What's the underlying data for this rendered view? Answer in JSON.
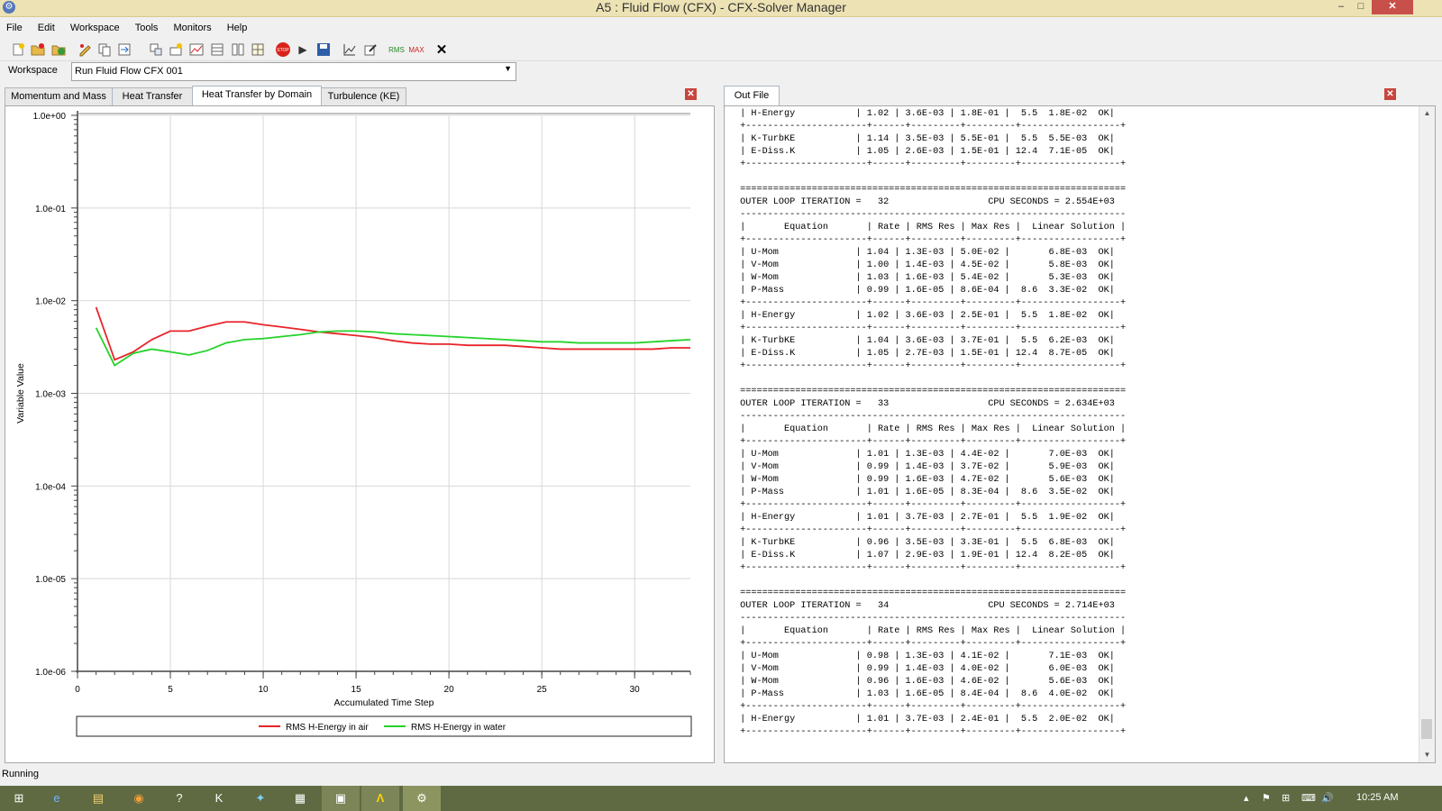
{
  "window": {
    "title": "A5 : Fluid Flow (CFX) - CFX-Solver Manager",
    "minimize": "–",
    "maximize": "□",
    "close": "✕"
  },
  "menu": [
    "File",
    "Edit",
    "Workspace",
    "Tools",
    "Monitors",
    "Help"
  ],
  "toolbar_icons": [
    "new-run-icon",
    "open-icon",
    "restart-icon",
    "edit-icon",
    "copy-icon",
    "sync-icon",
    "arrange-icon",
    "layout-icon",
    "monitor-icon",
    "grid-icon",
    "table-icon",
    "layout2-icon",
    "stop-icon",
    "play-icon",
    "save-icon",
    "chart-edit-icon",
    "pencil-icon",
    "rms-icon",
    "max-icon",
    "close-icon"
  ],
  "toolbar_glyphs": {
    "stop": "STOP",
    "play": "▶",
    "rms": "RMS",
    "max": "MAX",
    "close": "✕"
  },
  "workspace": {
    "label": "Workspace",
    "value": "Run Fluid Flow CFX 001"
  },
  "tabs": [
    "Momentum and Mass",
    "Heat Transfer",
    "Heat Transfer by Domain",
    "Turbulence (KE)"
  ],
  "active_tab": 2,
  "out_tab": "Out File",
  "chart_data": {
    "type": "line",
    "xlabel": "Accumulated Time Step",
    "ylabel": "Variable Value",
    "yscale": "log",
    "xlim": [
      0,
      33
    ],
    "ylim": [
      1e-06,
      1.0
    ],
    "x_ticks": [
      0,
      5,
      10,
      15,
      20,
      25,
      30
    ],
    "y_ticks": [
      1.0,
      0.1,
      0.01,
      0.001,
      0.0001,
      1e-05,
      1e-06
    ],
    "y_tick_labels": [
      "1.0e+00",
      "1.0e-01",
      "1.0e-02",
      "1.0e-03",
      "1.0e-04",
      "1.0e-05",
      "1.0e-06"
    ],
    "grid": true,
    "legend_position": "bottom",
    "series": [
      {
        "name": "RMS H-Energy in air",
        "color": "#e8242a",
        "x": [
          1,
          2,
          3,
          4,
          5,
          6,
          7,
          8,
          9,
          10,
          11,
          12,
          13,
          14,
          15,
          16,
          17,
          18,
          19,
          20,
          21,
          22,
          23,
          24,
          25,
          26,
          27,
          28,
          29,
          30,
          31,
          32,
          33
        ],
        "y": [
          0.0085,
          0.0023,
          0.0028,
          0.0038,
          0.0047,
          0.0047,
          0.0053,
          0.0059,
          0.0059,
          0.0055,
          0.0052,
          0.0049,
          0.0046,
          0.0044,
          0.0042,
          0.004,
          0.0037,
          0.0035,
          0.0034,
          0.0034,
          0.0033,
          0.0033,
          0.0033,
          0.0032,
          0.0031,
          0.003,
          0.003,
          0.003,
          0.003,
          0.003,
          0.003,
          0.0031,
          0.0031
        ]
      },
      {
        "name": "RMS H-Energy in water",
        "color": "#25d22a",
        "x": [
          1,
          2,
          3,
          4,
          5,
          6,
          7,
          8,
          9,
          10,
          11,
          12,
          13,
          14,
          15,
          16,
          17,
          18,
          19,
          20,
          21,
          22,
          23,
          24,
          25,
          26,
          27,
          28,
          29,
          30,
          31,
          32,
          33
        ],
        "y": [
          0.0051,
          0.002,
          0.0027,
          0.003,
          0.0028,
          0.0026,
          0.0029,
          0.0035,
          0.0038,
          0.0039,
          0.0041,
          0.0043,
          0.0046,
          0.0047,
          0.0047,
          0.0046,
          0.0044,
          0.0043,
          0.0042,
          0.0041,
          0.004,
          0.0039,
          0.0038,
          0.0037,
          0.0036,
          0.0036,
          0.0035,
          0.0035,
          0.0035,
          0.0035,
          0.0036,
          0.0037,
          0.0038
        ]
      }
    ]
  },
  "out_file_text": " | H-Energy           | 1.02 | 3.6E-03 | 1.8E-01 |  5.5  1.8E-02  OK|\n +----------------------+------+---------+---------+------------------+\n | K-TurbKE           | 1.14 | 3.5E-03 | 5.5E-01 |  5.5  5.5E-03  OK|\n | E-Diss.K           | 1.05 | 2.6E-03 | 1.5E-01 | 12.4  7.1E-05  OK|\n +----------------------+------+---------+---------+------------------+\n\n ======================================================================\n OUTER LOOP ITERATION =   32                  CPU SECONDS = 2.554E+03\n ----------------------------------------------------------------------\n |       Equation       | Rate | RMS Res | Max Res |  Linear Solution |\n +----------------------+------+---------+---------+------------------+\n | U-Mom              | 1.04 | 1.3E-03 | 5.0E-02 |       6.8E-03  OK|\n | V-Mom              | 1.00 | 1.4E-03 | 4.5E-02 |       5.8E-03  OK|\n | W-Mom              | 1.03 | 1.6E-03 | 5.4E-02 |       5.3E-03  OK|\n | P-Mass             | 0.99 | 1.6E-05 | 8.6E-04 |  8.6  3.3E-02  OK|\n +----------------------+------+---------+---------+------------------+\n | H-Energy           | 1.02 | 3.6E-03 | 2.5E-01 |  5.5  1.8E-02  OK|\n +----------------------+------+---------+---------+------------------+\n | K-TurbKE           | 1.04 | 3.6E-03 | 3.7E-01 |  5.5  6.2E-03  OK|\n | E-Diss.K           | 1.05 | 2.7E-03 | 1.5E-01 | 12.4  8.7E-05  OK|\n +----------------------+------+---------+---------+------------------+\n\n ======================================================================\n OUTER LOOP ITERATION =   33                  CPU SECONDS = 2.634E+03\n ----------------------------------------------------------------------\n |       Equation       | Rate | RMS Res | Max Res |  Linear Solution |\n +----------------------+------+---------+---------+------------------+\n | U-Mom              | 1.01 | 1.3E-03 | 4.4E-02 |       7.0E-03  OK|\n | V-Mom              | 0.99 | 1.4E-03 | 3.7E-02 |       5.9E-03  OK|\n | W-Mom              | 0.99 | 1.6E-03 | 4.7E-02 |       5.6E-03  OK|\n | P-Mass             | 1.01 | 1.6E-05 | 8.3E-04 |  8.6  3.5E-02  OK|\n +----------------------+------+---------+---------+------------------+\n | H-Energy           | 1.01 | 3.7E-03 | 2.7E-01 |  5.5  1.9E-02  OK|\n +----------------------+------+---------+---------+------------------+\n | K-TurbKE           | 0.96 | 3.5E-03 | 3.3E-01 |  5.5  6.8E-03  OK|\n | E-Diss.K           | 1.07 | 2.9E-03 | 1.9E-01 | 12.4  8.2E-05  OK|\n +----------------------+------+---------+---------+------------------+\n\n ======================================================================\n OUTER LOOP ITERATION =   34                  CPU SECONDS = 2.714E+03\n ----------------------------------------------------------------------\n |       Equation       | Rate | RMS Res | Max Res |  Linear Solution |\n +----------------------+------+---------+---------+------------------+\n | U-Mom              | 0.98 | 1.3E-03 | 4.1E-02 |       7.1E-03  OK|\n | V-Mom              | 0.99 | 1.4E-03 | 4.0E-02 |       6.0E-03  OK|\n | W-Mom              | 0.96 | 1.6E-03 | 4.6E-02 |       5.6E-03  OK|\n | P-Mass             | 1.03 | 1.6E-05 | 8.4E-04 |  8.6  4.0E-02  OK|\n +----------------------+------+---------+---------+------------------+\n | H-Energy           | 1.01 | 3.7E-03 | 2.4E-01 |  5.5  2.0E-02  OK|\n +----------------------+------+---------+---------+------------------+",
  "status": "Running",
  "taskbar": {
    "items": [
      "windows-start-icon",
      "ie-icon",
      "file-explorer-icon",
      "chrome-icon",
      "help-icon",
      "k-icon",
      "butterfly-icon",
      "app-icon",
      "folder-icon",
      "ansys-icon",
      "cfx-solver-icon"
    ],
    "glyphs": [
      "⊞",
      "e",
      "▤",
      "◉",
      "?",
      "K",
      "✦",
      "▦",
      "▣",
      "Λ",
      "⚙"
    ],
    "tray_glyphs": [
      "▴",
      "⚑",
      "⊞",
      "⌨",
      "🔊"
    ],
    "clock": "10:25 AM"
  }
}
